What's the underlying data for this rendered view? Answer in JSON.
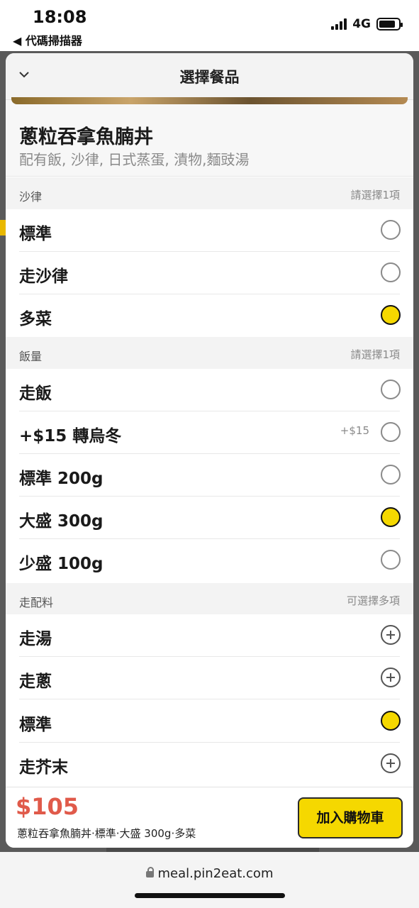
{
  "status_bar": {
    "time": "18:08",
    "back_label": "◀ 代碼掃描器",
    "network": "4G"
  },
  "sheet": {
    "title": "選擇餐品",
    "close_icon": "chevron-down-icon"
  },
  "dish": {
    "name": "蔥粒吞拿魚腩丼",
    "description": "配有飯, 沙律, 日式蒸蛋, 漬物,麵豉湯"
  },
  "sections": [
    {
      "name": "沙律",
      "hint": "請選擇1項",
      "options": [
        {
          "label": "標準",
          "price": "",
          "selected": false
        },
        {
          "label": "走沙律",
          "price": "",
          "selected": false
        },
        {
          "label": "多菜",
          "price": "",
          "selected": true
        }
      ]
    },
    {
      "name": "飯量",
      "hint": "請選擇1項",
      "options": [
        {
          "label": "走飯",
          "price": "",
          "selected": false
        },
        {
          "label": "+$15 轉烏冬",
          "price": "+$15",
          "selected": false
        },
        {
          "label": "標準 200g",
          "price": "",
          "selected": false
        },
        {
          "label": "大盛 300g",
          "price": "",
          "selected": true
        },
        {
          "label": "少盛 100g",
          "price": "",
          "selected": false
        }
      ]
    },
    {
      "name": "走配料",
      "hint": "可選擇多項",
      "options": [
        {
          "label": "走湯",
          "price": "",
          "selected": false
        },
        {
          "label": "走蔥",
          "price": "",
          "selected": false
        },
        {
          "label": "標準",
          "price": "",
          "selected": true
        },
        {
          "label": "走芥末",
          "price": "",
          "selected": false
        }
      ]
    }
  ],
  "footer": {
    "total": "$105",
    "summary": "蔥粒吞拿魚腩丼·標準·大盛 300g·多菜",
    "cart_button": "加入購物車"
  },
  "browser": {
    "url": "meal.pin2eat.com"
  },
  "colors": {
    "accent_yellow": "#f5d800",
    "price_red": "#e05a4a"
  }
}
